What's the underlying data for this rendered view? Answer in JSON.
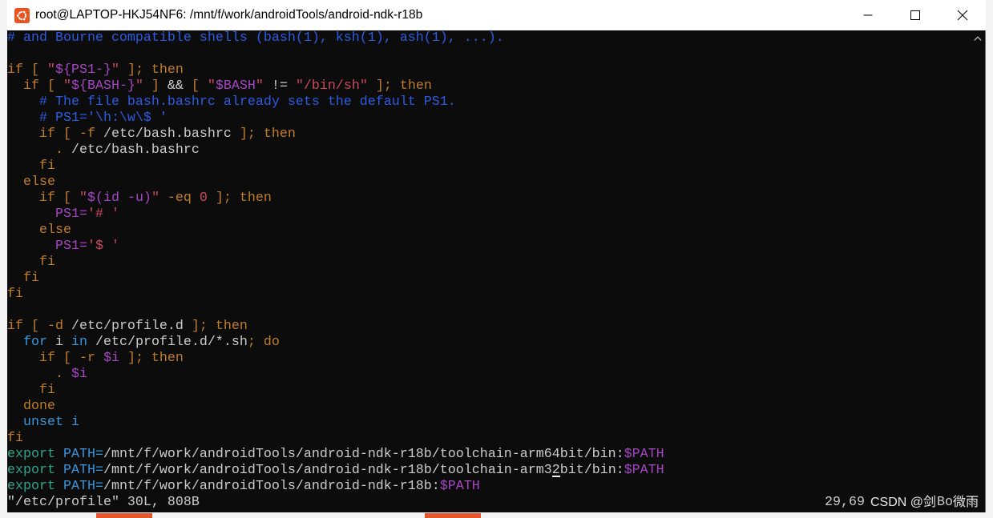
{
  "window": {
    "title": "root@LAPTOP-HKJ54NF6: /mnt/f/work/androidTools/android-ndk-r18b"
  },
  "icons": {
    "app": "ubuntu-icon",
    "minimize": "minimize-icon",
    "maximize": "maximize-icon",
    "close": "close-icon",
    "scroll_up": "chevron-up-icon"
  },
  "theme": {
    "titlebar_background": "#ffffff",
    "terminal_background": "#0c0c0c",
    "terminal_foreground": "#cccccc",
    "app_icon_color": "#e95420"
  },
  "syntax_colors": {
    "plain": "#cccccc",
    "comment": "#2d5be3",
    "keyword": "#c07d2c",
    "string": "#c94a5e",
    "variable": "#a646c4",
    "builtin": "#3a96dd",
    "export": "#2fa58c"
  },
  "editor": {
    "lines": [
      [
        {
          "t": "# and Bourne compatible shells (bash(1), ksh(1), ash(1), ...).",
          "c": "comment"
        }
      ],
      [],
      [
        {
          "t": "if [ ",
          "c": "keyword"
        },
        {
          "t": "\"",
          "c": "string"
        },
        {
          "t": "${PS1-}",
          "c": "variable"
        },
        {
          "t": "\"",
          "c": "string"
        },
        {
          "t": " ]; then",
          "c": "keyword"
        }
      ],
      [
        {
          "t": "  if [ ",
          "c": "keyword"
        },
        {
          "t": "\"",
          "c": "string"
        },
        {
          "t": "${BASH-}",
          "c": "variable"
        },
        {
          "t": "\"",
          "c": "string"
        },
        {
          "t": " ]",
          "c": "keyword"
        },
        {
          "t": " && ",
          "c": "plain"
        },
        {
          "t": "[ ",
          "c": "keyword"
        },
        {
          "t": "\"",
          "c": "string"
        },
        {
          "t": "$BASH",
          "c": "variable"
        },
        {
          "t": "\"",
          "c": "string"
        },
        {
          "t": " != ",
          "c": "plain"
        },
        {
          "t": "\"/bin/sh\"",
          "c": "string"
        },
        {
          "t": " ]; then",
          "c": "keyword"
        }
      ],
      [
        {
          "t": "    # The file bash.bashrc already sets the default PS1.",
          "c": "comment"
        }
      ],
      [
        {
          "t": "    # PS1='\\h:\\w\\$ '",
          "c": "comment"
        }
      ],
      [
        {
          "t": "    if [ -f ",
          "c": "keyword"
        },
        {
          "t": "/etc/bash.bashrc",
          "c": "plain"
        },
        {
          "t": " ]; then",
          "c": "keyword"
        }
      ],
      [
        {
          "t": "      . ",
          "c": "keyword"
        },
        {
          "t": "/etc/bash.bashrc",
          "c": "plain"
        }
      ],
      [
        {
          "t": "    fi",
          "c": "keyword"
        }
      ],
      [
        {
          "t": "  else",
          "c": "keyword"
        }
      ],
      [
        {
          "t": "    if [ ",
          "c": "keyword"
        },
        {
          "t": "\"",
          "c": "string"
        },
        {
          "t": "$(id -u)",
          "c": "variable"
        },
        {
          "t": "\"",
          "c": "string"
        },
        {
          "t": " -eq ",
          "c": "keyword"
        },
        {
          "t": "0",
          "c": "string"
        },
        {
          "t": " ]; then",
          "c": "keyword"
        }
      ],
      [
        {
          "t": "      ",
          "c": "plain"
        },
        {
          "t": "PS1=",
          "c": "variable"
        },
        {
          "t": "'# '",
          "c": "string"
        }
      ],
      [
        {
          "t": "    else",
          "c": "keyword"
        }
      ],
      [
        {
          "t": "      ",
          "c": "plain"
        },
        {
          "t": "PS1=",
          "c": "variable"
        },
        {
          "t": "'$ '",
          "c": "string"
        }
      ],
      [
        {
          "t": "    fi",
          "c": "keyword"
        }
      ],
      [
        {
          "t": "  fi",
          "c": "keyword"
        }
      ],
      [
        {
          "t": "fi",
          "c": "keyword"
        }
      ],
      [],
      [
        {
          "t": "if [ -d ",
          "c": "keyword"
        },
        {
          "t": "/etc/profile.d",
          "c": "plain"
        },
        {
          "t": " ]; then",
          "c": "keyword"
        }
      ],
      [
        {
          "t": "  for",
          "c": "builtin"
        },
        {
          "t": " i ",
          "c": "plain"
        },
        {
          "t": "in",
          "c": "builtin"
        },
        {
          "t": " /etc/profile.d/*.sh",
          "c": "plain"
        },
        {
          "t": "; do",
          "c": "keyword"
        }
      ],
      [
        {
          "t": "    if [ -r ",
          "c": "keyword"
        },
        {
          "t": "$i",
          "c": "variable"
        },
        {
          "t": " ]; then",
          "c": "keyword"
        }
      ],
      [
        {
          "t": "      . ",
          "c": "keyword"
        },
        {
          "t": "$i",
          "c": "variable"
        }
      ],
      [
        {
          "t": "    fi",
          "c": "keyword"
        }
      ],
      [
        {
          "t": "  done",
          "c": "keyword"
        }
      ],
      [
        {
          "t": "  unset i",
          "c": "builtin"
        }
      ],
      [
        {
          "t": "fi",
          "c": "keyword"
        }
      ],
      [
        {
          "t": "export",
          "c": "export"
        },
        {
          "t": " ",
          "c": "plain"
        },
        {
          "t": "PATH=",
          "c": "builtin"
        },
        {
          "t": "/mnt/f/work/androidTools/android-ndk-r18b/toolchain-arm64bit/bin:",
          "c": "plain"
        },
        {
          "t": "$PATH",
          "c": "variable"
        }
      ],
      [
        {
          "t": "export",
          "c": "export"
        },
        {
          "t": " ",
          "c": "plain"
        },
        {
          "t": "PATH=",
          "c": "builtin"
        },
        {
          "t": "/mnt/f/work/androidTools/android-ndk-r18b/toolchain-arm3",
          "c": "plain"
        },
        {
          "t": "2",
          "c": "plain",
          "cursor": true
        },
        {
          "t": "bit/bin:",
          "c": "plain"
        },
        {
          "t": "$PATH",
          "c": "variable"
        }
      ],
      [
        {
          "t": "export",
          "c": "export"
        },
        {
          "t": " ",
          "c": "plain"
        },
        {
          "t": "PATH=",
          "c": "builtin"
        },
        {
          "t": "/mnt/f/work/androidTools/android-ndk-r18b:",
          "c": "plain"
        },
        {
          "t": "$PATH",
          "c": "variable"
        }
      ]
    ]
  },
  "status": {
    "message": "\"/etc/profile\" 30L, 808B",
    "ruler_position": "29,69",
    "ruler_scroll": "Bo"
  },
  "watermark": {
    "text_start": "CSDN @剑",
    "text_end": "微雨"
  }
}
